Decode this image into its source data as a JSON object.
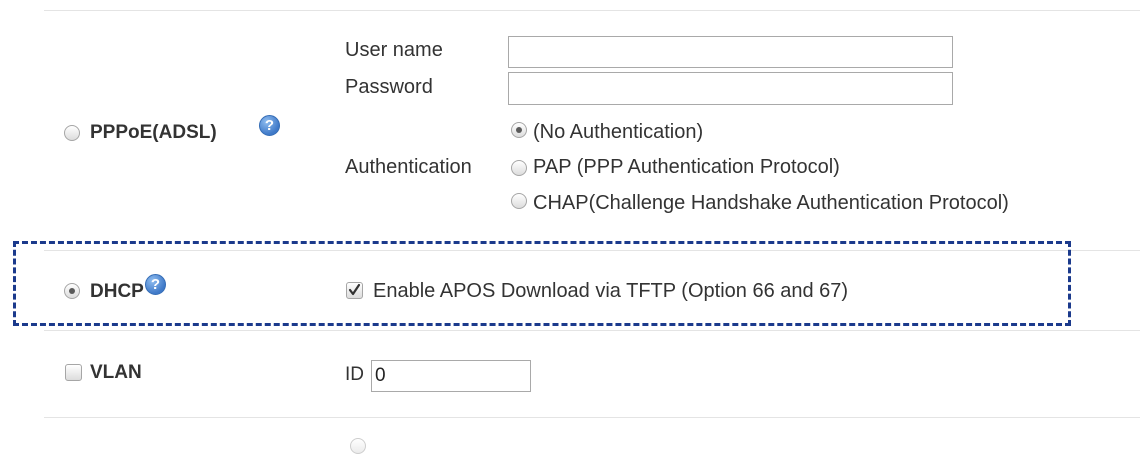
{
  "pppoe": {
    "label": "PPPoE(ADSL)",
    "help_icon": "question-circle-icon",
    "selected": false,
    "username_label": "User name",
    "username_value": "",
    "password_label": "Password",
    "password_value": "",
    "auth_label": "Authentication",
    "auth_options": [
      {
        "label": "(No Authentication)",
        "selected": true
      },
      {
        "label": "PAP (PPP Authentication Protocol)",
        "selected": false
      },
      {
        "label": "CHAP(Challenge Handshake Authentication Protocol)",
        "selected": false
      }
    ]
  },
  "dhcp": {
    "label": "DHCP",
    "help_icon": "question-circle-icon",
    "selected": true,
    "tftp_label": "Enable APOS Download via TFTP (Option 66 and 67)",
    "tftp_checked": true
  },
  "vlan": {
    "label": "VLAN",
    "checked": false,
    "id_label": "ID",
    "id_value": "0"
  },
  "colors": {
    "highlight_border": "#1b3a8c",
    "help_icon": "#3f79c8"
  }
}
